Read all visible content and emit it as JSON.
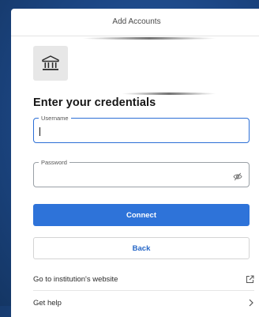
{
  "header": {
    "title": "Add Accounts"
  },
  "institution": {
    "icon": "bank-icon"
  },
  "form": {
    "title": "Enter your credentials",
    "username": {
      "label": "Username",
      "value": ""
    },
    "password": {
      "label": "Password",
      "value": "",
      "toggle_icon": "eye-slash-icon"
    }
  },
  "buttons": {
    "connect": "Connect",
    "back": "Back"
  },
  "links": {
    "website": {
      "label": "Go to institution's website",
      "icon": "external-link-icon"
    },
    "help": {
      "label": "Get help",
      "icon": "chevron-right-icon"
    }
  },
  "colors": {
    "primary": "#2e73d9",
    "background": "#1c4684",
    "focus_border": "#2c6fd6"
  }
}
